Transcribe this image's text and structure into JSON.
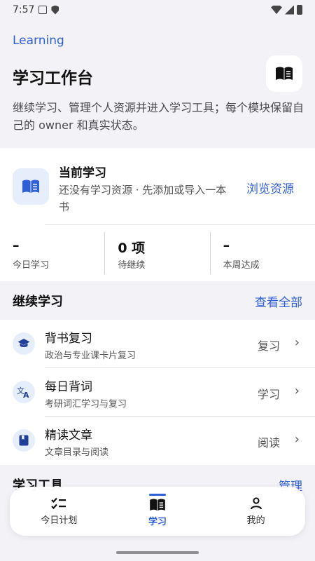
{
  "status_bar": {
    "time": "7:57"
  },
  "header": {
    "eyebrow": "Learning",
    "title": "学习工作台",
    "subtitle": "继续学习、管理个人资源并进入学习工具；每个模块保留自己的 owner 和真实状态。"
  },
  "current_card": {
    "title": "当前学习",
    "description": "还没有学习资源 · 先添加或导入一本书",
    "browse_label": "浏览资源",
    "stats": [
      {
        "value": "–",
        "label": "今日学习"
      },
      {
        "value": "0 项",
        "label": "待继续"
      },
      {
        "value": "–",
        "label": "本周达成"
      }
    ]
  },
  "continue_section": {
    "title": "继续学习",
    "link": "查看全部",
    "items": [
      {
        "title": "背书复习",
        "subtitle": "政治与专业课卡片复习",
        "action": "复习",
        "icon": "graduation-cap-icon"
      },
      {
        "title": "每日背词",
        "subtitle": "考研词汇学习与复习",
        "action": "学习",
        "icon": "translate-icon"
      },
      {
        "title": "精读文章",
        "subtitle": "文章目录与阅读",
        "action": "阅读",
        "icon": "bookmark-book-icon"
      }
    ]
  },
  "tools_section": {
    "title": "学习工具",
    "link": "管理"
  },
  "bottom_nav": {
    "items": [
      {
        "label": "今日计划",
        "icon": "checklist-icon"
      },
      {
        "label": "学习",
        "icon": "open-book-icon"
      },
      {
        "label": "我的",
        "icon": "person-icon"
      }
    ]
  },
  "colors": {
    "accent": "#2f5fd6",
    "background": "#f2f2f7",
    "card": "#ffffff"
  }
}
